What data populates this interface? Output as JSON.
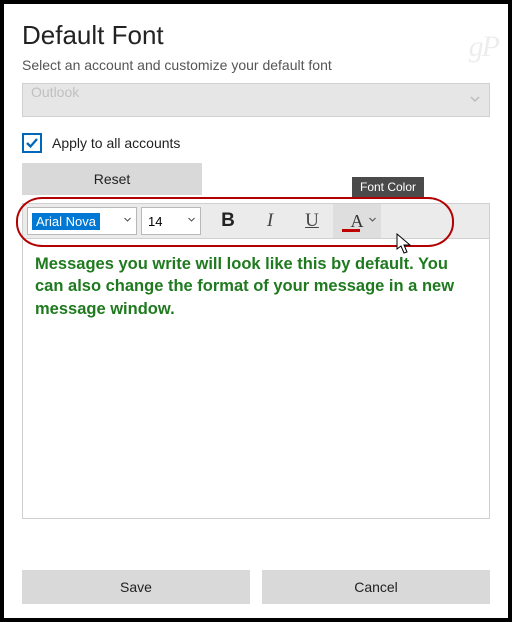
{
  "watermark": "gP",
  "title": "Default Font",
  "subtitle": "Select an account and customize your default font",
  "account_select": {
    "value": "Outlook"
  },
  "apply_all": {
    "checked": true,
    "label": "Apply to all accounts"
  },
  "reset_label": "Reset",
  "toolbar": {
    "font_name": "Arial Nova",
    "font_size": "14",
    "bold_glyph": "B",
    "italic_glyph": "I",
    "underline_glyph": "U",
    "color_glyph": "A",
    "tooltip": "Font Color"
  },
  "preview_text": "Messages you write will look like this by default. You can also change the format of your message in a new message window.",
  "footer": {
    "save": "Save",
    "cancel": "Cancel"
  }
}
